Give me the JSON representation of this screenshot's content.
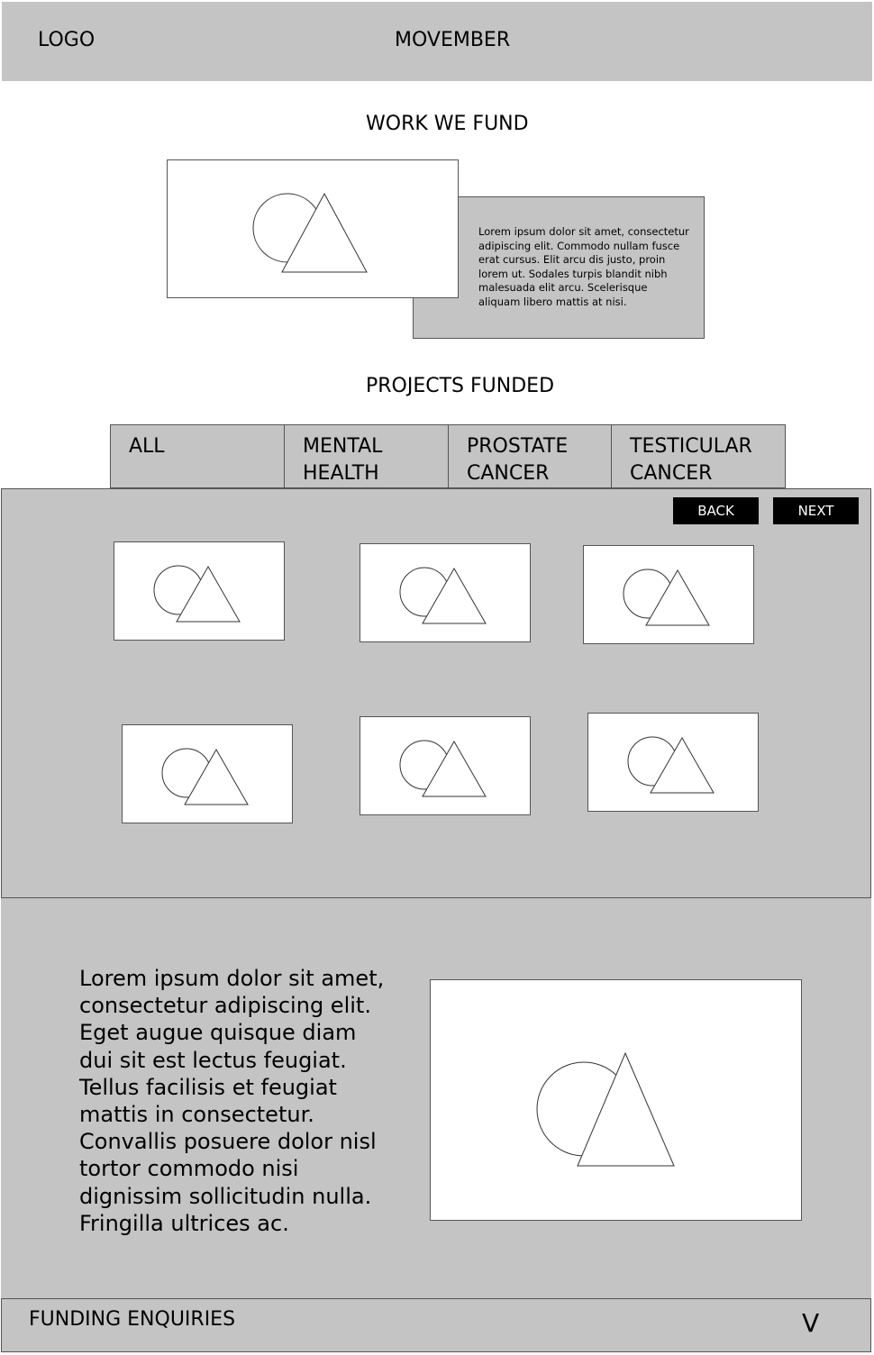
{
  "header": {
    "logo": "LOGO",
    "brand": "MOVEMBER"
  },
  "work_we_fund": {
    "title": "WORK WE FUND",
    "text": "Lorem ipsum dolor sit amet, consectetur adipiscing elit. Commodo nullam fusce erat cursus. Elit arcu dis justo, proin lorem ut. Sodales turpis blandit nibh malesuada elit arcu. Scelerisque aliquam libero mattis at nisi."
  },
  "projects_funded": {
    "title": "PROJECTS FUNDED",
    "tabs": [
      {
        "line1": "ALL",
        "line2": ""
      },
      {
        "line1": "MENTAL",
        "line2": "HEALTH"
      },
      {
        "line1": "PROSTATE",
        "line2": "CANCER"
      },
      {
        "line1": "TESTICULAR",
        "line2": "CANCER"
      }
    ],
    "back_label": "BACK",
    "next_label": "NEXT"
  },
  "lower": {
    "text": "Lorem ipsum dolor sit amet, consectetur adipiscing elit. Eget augue quisque diam dui sit est lectus feugiat. Tellus facilisis et feugiat mattis in consectetur. Convallis posuere dolor nisl tortor commodo nisi dignissim sollicitudin nulla. Fringilla ultrices ac."
  },
  "footer": {
    "label": "FUNDING ENQUIRIES",
    "chevron": "V"
  },
  "colors": {
    "panel": "#c4c4c4",
    "button": "#000000",
    "background": "#ffffff"
  },
  "icons": {
    "placeholder": "image-placeholder-icon"
  }
}
